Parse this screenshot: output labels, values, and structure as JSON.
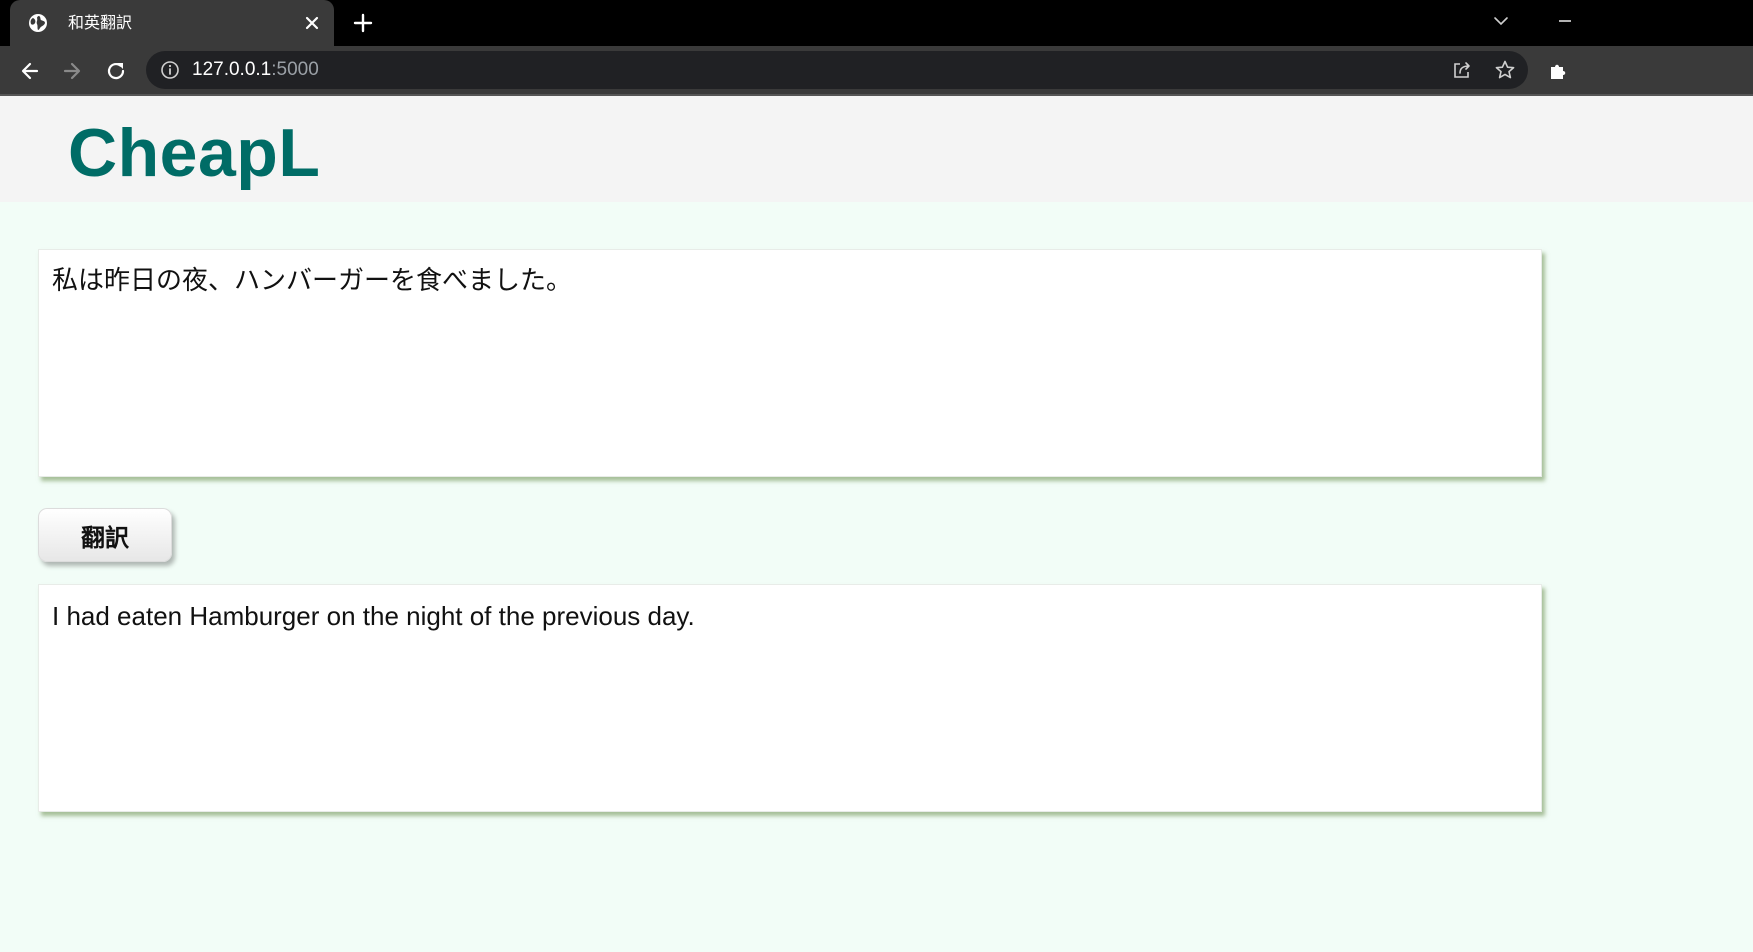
{
  "browser": {
    "tab_title": "和英翻訳",
    "url_host": "127.0.0.1",
    "url_port": ":5000",
    "icons": {
      "favicon": "globe-icon",
      "tab_close": "close-icon",
      "new_tab": "plus-icon",
      "tab_search": "chevron-down-icon",
      "back": "arrow-left-icon",
      "forward": "arrow-right-icon",
      "reload": "reload-icon",
      "site_info": "info-icon",
      "share": "share-icon",
      "bookmark": "star-icon",
      "extensions": "puzzle-icon",
      "minimize": "minimize-icon"
    }
  },
  "header": {
    "logo": "CheapL",
    "logo_color": "#006c66"
  },
  "main": {
    "source_text": "私は昨日の夜、ハンバーガーを食べました。",
    "translate_label": "翻訳",
    "result_text": "I had eaten Hamburger on the night of the previous day."
  }
}
